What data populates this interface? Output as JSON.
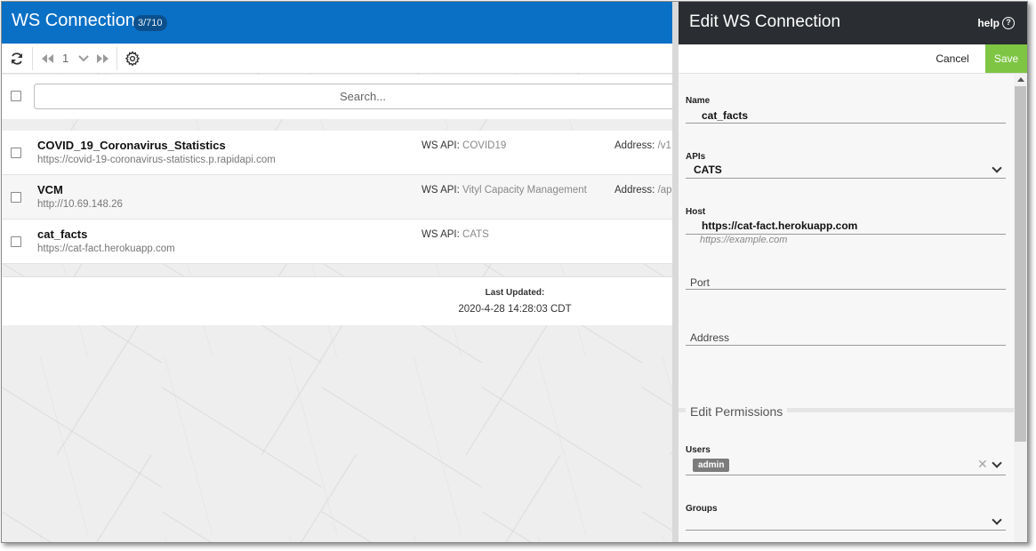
{
  "app": {
    "title": "WS Connections",
    "count_badge": "3/710"
  },
  "toolbar": {
    "refresh_icon": "refresh-icon",
    "prev_icon": "double-chevron-left-icon",
    "page": "1",
    "page_dropdown_icon": "chevron-down-icon",
    "next_icon": "double-chevron-right-icon",
    "settings_icon": "gear-icon"
  },
  "search": {
    "placeholder": "Search..."
  },
  "connections": [
    {
      "name": "COVID_19_Coronavirus_Statistics",
      "url": "https://covid-19-coronavirus-statistics.p.rapidapi.com",
      "api_label": "WS API:",
      "api": "COVID19",
      "address_label": "Address:",
      "address": "/v1"
    },
    {
      "name": "VCM",
      "url": "http://10.69.148.26",
      "api_label": "WS API:",
      "api": "Vityl Capacity Management",
      "address_label": "Address:",
      "address": "/api"
    },
    {
      "name": "cat_facts",
      "url": "https://cat-fact.herokuapp.com",
      "api_label": "WS API:",
      "api": "CATS",
      "address_label": "",
      "address": ""
    }
  ],
  "footer": {
    "label": "Last Updated:",
    "value": "2020-4-28 14:28:03 CDT"
  },
  "panel": {
    "title": "Edit WS Connection",
    "help_label": "help",
    "help_icon": "question-circle-icon",
    "cancel_label": "Cancel",
    "save_label": "Save",
    "save_color": "#7ec544",
    "fields": {
      "name_label": "Name",
      "name_value": "cat_facts",
      "apis_label": "APIs",
      "apis_value": "CATS",
      "host_label": "Host",
      "host_value": "https://cat-fact.herokuapp.com",
      "host_hint": "https://example.com",
      "port_placeholder": "Port",
      "address_placeholder": "Address"
    },
    "permissions": {
      "section_title": "Edit Permissions",
      "users_label": "Users",
      "users_chip": "admin",
      "groups_label": "Groups"
    }
  },
  "colors": {
    "topbar": "#0a70c6",
    "panel_header": "#2a2d31"
  }
}
